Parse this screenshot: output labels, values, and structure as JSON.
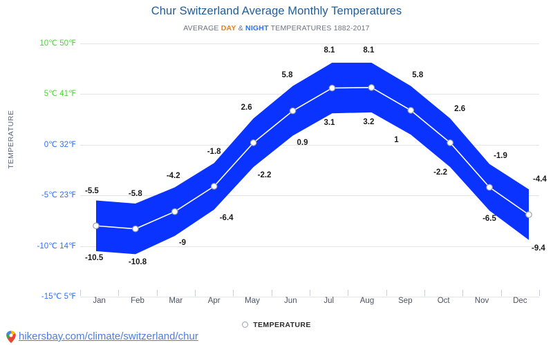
{
  "chart": {
    "title": "Chur Switzerland Average Monthly Temperatures",
    "subtitle": {
      "prefix": "AVERAGE ",
      "day": "DAY",
      "amp": " & ",
      "night": "NIGHT",
      "suffix": " TEMPERATURES 1882-2017"
    },
    "y_axis_title": "TEMPERATURE",
    "legend_label": "TEMPERATURE",
    "colors": {
      "title": "#1f5c99",
      "day": "#ff7a00",
      "night": "#2d6ff7",
      "tick_warm": "#4cd137",
      "tick_cold": "#2d6ff7",
      "gridline": "#e4e4e4",
      "line": "#ffffff",
      "marker_fill": "#ffffff",
      "marker_stroke": "#9aa0ab",
      "link": "#4c7fe0"
    }
  },
  "footer": {
    "link_text": "hikersbay.com/climate/switzerland/chur",
    "pin_icon": "map-pin-icon"
  },
  "chart_data": {
    "type": "area",
    "title": "Chur Switzerland Average Monthly Temperatures",
    "subtitle": "AVERAGE DAY & NIGHT TEMPERATURES 1882-2017",
    "xlabel": "",
    "ylabel": "TEMPERATURE",
    "categories": [
      "Jan",
      "Feb",
      "Mar",
      "Apr",
      "May",
      "Jun",
      "Jul",
      "Aug",
      "Sep",
      "Oct",
      "Nov",
      "Dec"
    ],
    "ylim": [
      -15,
      10
    ],
    "yticks": [
      {
        "value": 10,
        "label": "10℃ 50℉",
        "color": "warm"
      },
      {
        "value": 5,
        "label": "5℃ 41℉",
        "color": "warm"
      },
      {
        "value": 0,
        "label": "0℃ 32℉",
        "color": "cold"
      },
      {
        "value": -5,
        "label": "-5℃ 23℉",
        "color": "cold"
      },
      {
        "value": -10,
        "label": "-10℃ 14℉",
        "color": "cold"
      },
      {
        "value": -15,
        "label": "-15℃ 5℉",
        "color": "cold"
      }
    ],
    "grid": true,
    "legend_position": "bottom",
    "series": [
      {
        "name": "DAY",
        "role": "upper",
        "values": [
          -5.5,
          -5.8,
          -4.2,
          -1.8,
          2.6,
          5.8,
          8.1,
          8.1,
          5.8,
          2.6,
          -1.9,
          -4.4
        ]
      },
      {
        "name": "NIGHT",
        "role": "lower",
        "values": [
          -10.5,
          -10.8,
          -9,
          -6.4,
          -2.2,
          0.9,
          3.1,
          3.2,
          1,
          -2.2,
          -6.5,
          -9.4
        ]
      },
      {
        "name": "TEMPERATURE",
        "role": "mean",
        "values": [
          -8,
          -8.3,
          -6.6,
          -4.1,
          0.2,
          3.35,
          5.6,
          5.65,
          3.4,
          0.2,
          -4.2,
          -6.9
        ]
      }
    ],
    "upper_labels": [
      "-5.5",
      "-5.8",
      "-4.2",
      "-1.8",
      "2.6",
      "5.8",
      "8.1",
      "8.1",
      "5.8",
      "2.6",
      "-1.9",
      "-4.4"
    ],
    "lower_labels": [
      "-10.5",
      "-10.8",
      "-9",
      "-6.4",
      "-2.2",
      "0.9",
      "3.1",
      "3.2",
      "1",
      "-2.2",
      "-6.5",
      "-9.4"
    ]
  }
}
